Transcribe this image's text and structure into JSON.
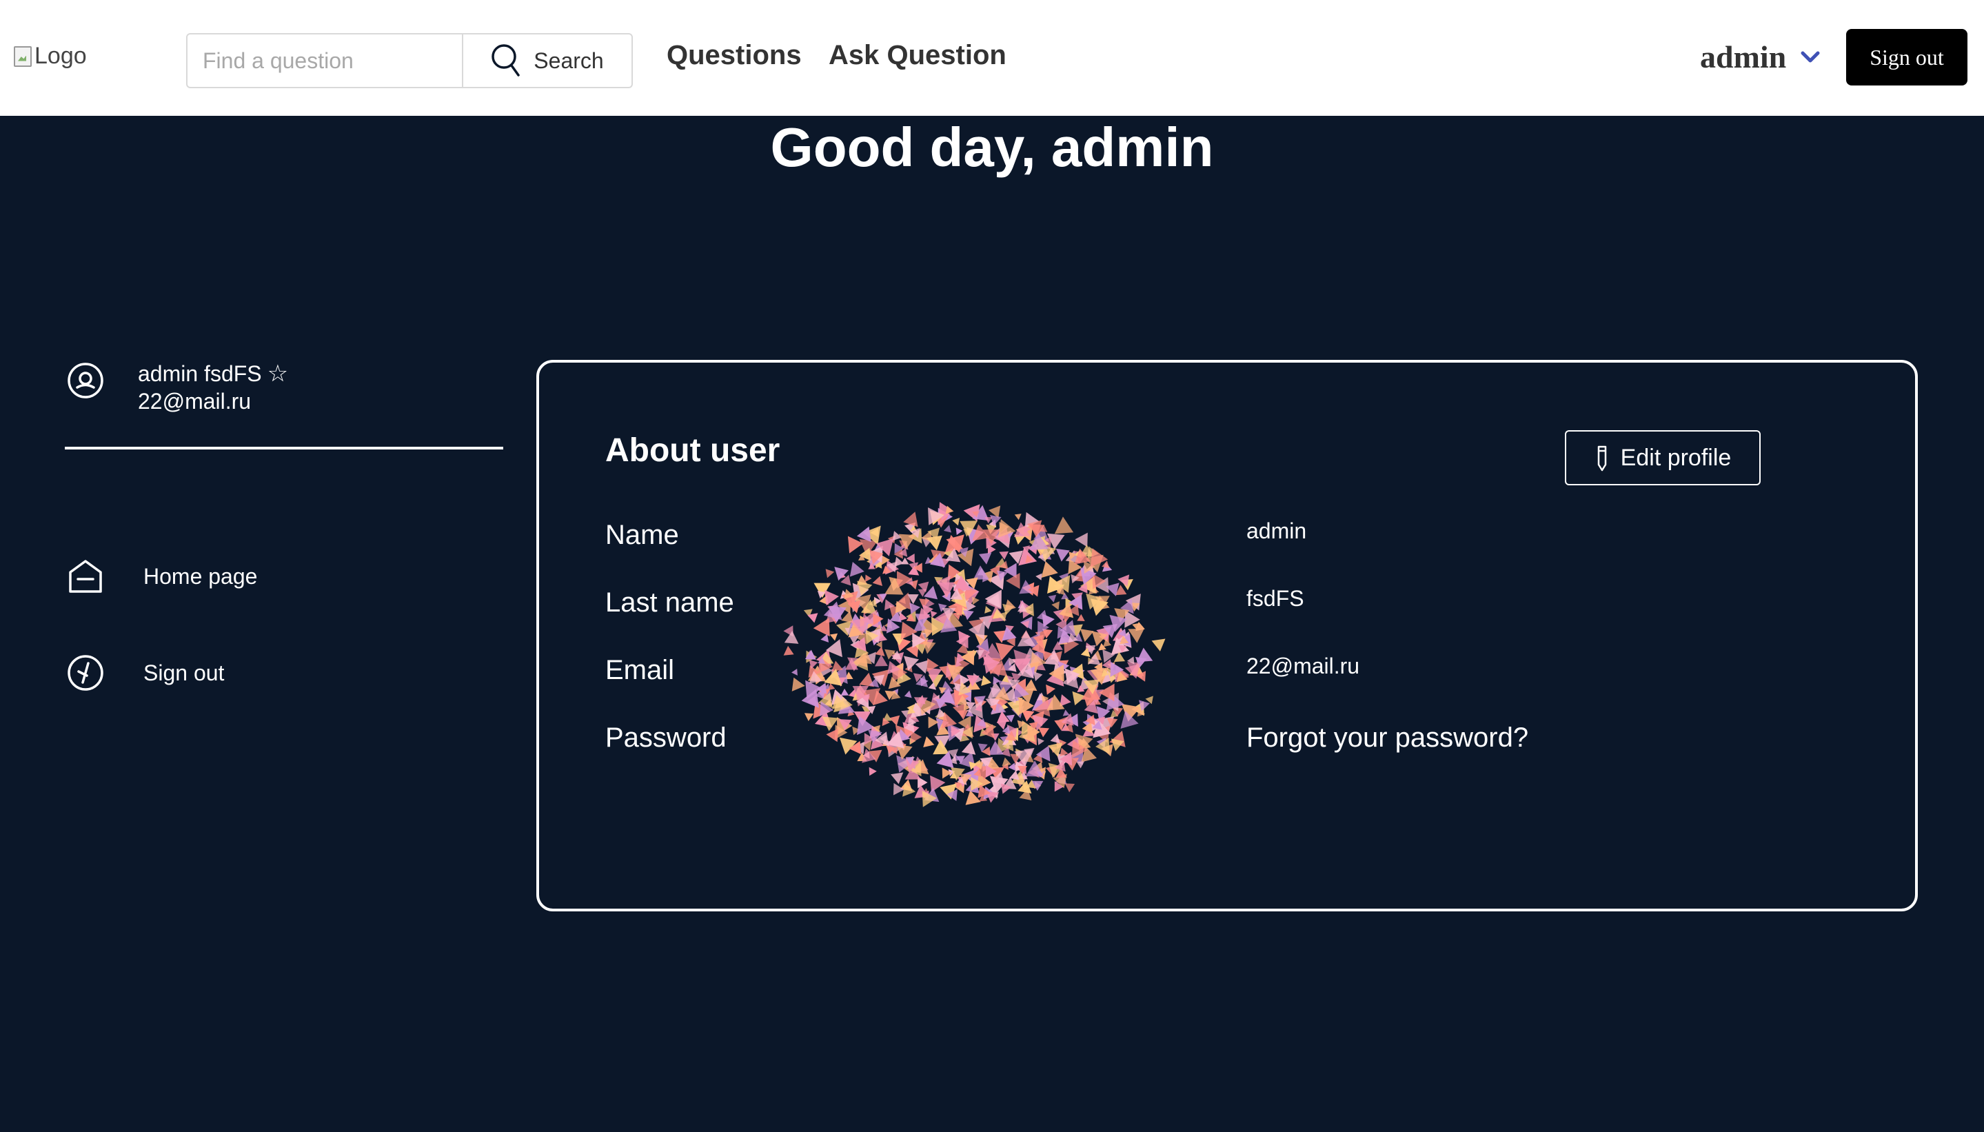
{
  "header": {
    "logo_alt": "Logo",
    "search": {
      "placeholder": "Find a question",
      "value": "",
      "button_label": "Search"
    },
    "nav": {
      "questions": "Questions",
      "ask_question": "Ask Question"
    },
    "user_name": "admin",
    "sign_out": "Sign out"
  },
  "greeting": "Good day, admin",
  "sidebar": {
    "user_display": "admin fsdFS",
    "email": "22@mail.ru",
    "items": [
      {
        "label": "Home page",
        "icon": "home-icon"
      },
      {
        "label": "Sign out",
        "icon": "sign-out-icon"
      }
    ]
  },
  "profile": {
    "title": "About user",
    "edit_label": "Edit profile",
    "fields": [
      {
        "label": "Name",
        "value": "admin"
      },
      {
        "label": "Last name",
        "value": "fsdFS"
      },
      {
        "label": "Email",
        "value": "22@mail.ru"
      },
      {
        "label": "Password",
        "value": "Forgot your password?"
      }
    ]
  },
  "colors": {
    "background": "#0b1729",
    "header_bg": "#ffffff",
    "accent": "#3f51b5",
    "confetti": [
      "#f48fb1",
      "#f8bbd0",
      "#ffb07c",
      "#ce93d8",
      "#ff8a80",
      "#ffcc80"
    ]
  }
}
